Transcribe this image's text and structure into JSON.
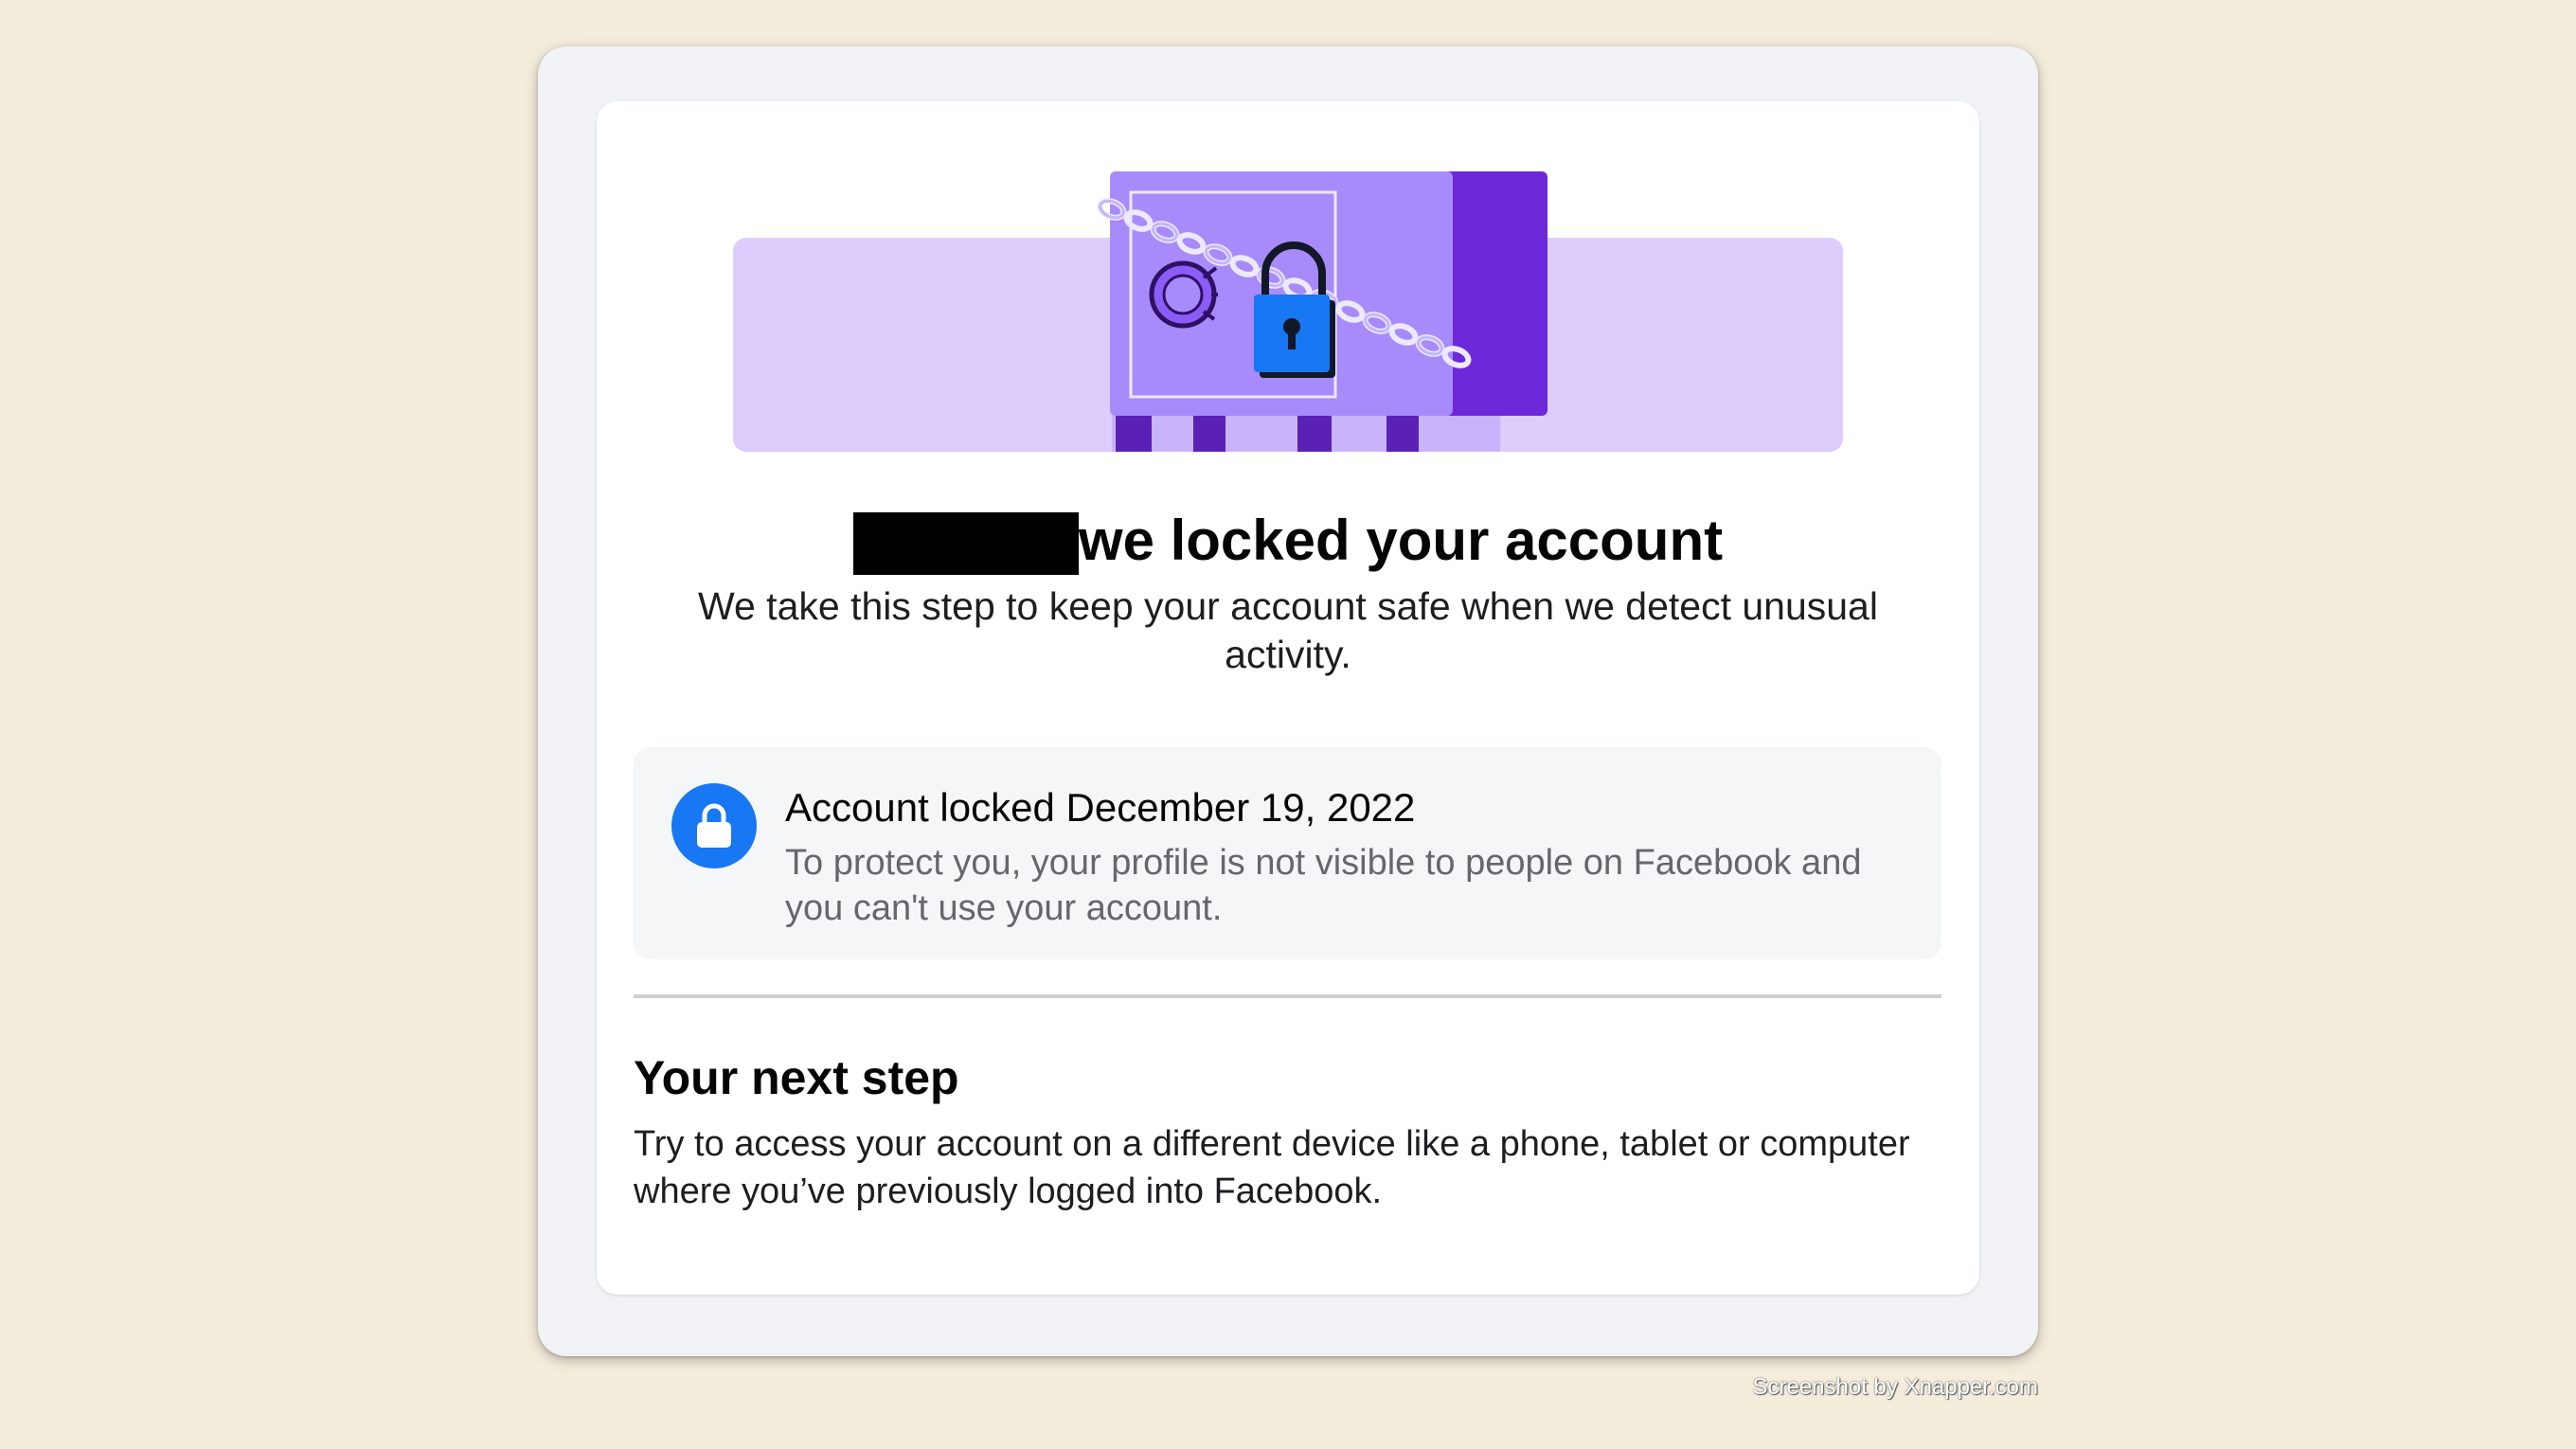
{
  "header": {
    "title": "we locked your account",
    "subtitle": "We take this step to keep your account safe when we detect unusual activity."
  },
  "status": {
    "title": "Account locked December 19, 2022",
    "description": "To protect you, your profile is not visible to people on Facebook and you can't use your account."
  },
  "next_step": {
    "title": "Your next step",
    "description": "Try to access your account on a different device like a phone, tablet or computer where you’ve previously logged into Facebook."
  },
  "watermark": "Screenshot by Xnapper.com",
  "icons": {
    "hero": "locked-safe-illustration",
    "status": "lock-icon"
  },
  "colors": {
    "background": "#f5eddc",
    "accent_blue": "#1877f2",
    "illustration_purple": "#a78bfa"
  }
}
